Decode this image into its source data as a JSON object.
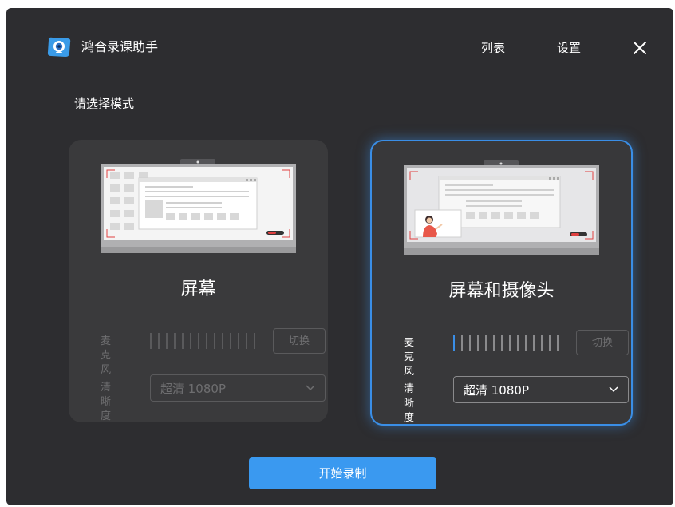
{
  "app": {
    "title": "鸿合录课助手",
    "icon": "webcam-app-icon"
  },
  "header": {
    "nav": [
      {
        "label": "列表"
      },
      {
        "label": "设置"
      }
    ],
    "close_icon": "close-icon"
  },
  "mode_prompt": "请选择模式",
  "modes": [
    {
      "title": "屏幕",
      "selected": false,
      "mic_label": "麦克风",
      "switch_label": "切换",
      "quality_label": "清晰度",
      "quality_value": "超清 1080P",
      "mic_level_active_bars": 0
    },
    {
      "title": "屏幕和摄像头",
      "selected": true,
      "mic_label": "麦克风",
      "switch_label": "切换",
      "quality_label": "清晰度",
      "quality_value": "超清 1080P",
      "mic_level_active_bars": 1
    }
  ],
  "start_button": "开始录制",
  "colors": {
    "accent": "#3a8ee6",
    "button": "#3a99f0",
    "window_bg": "#2d2d30",
    "card_bg": "#3a3a3c",
    "recording_red": "#e04040"
  }
}
